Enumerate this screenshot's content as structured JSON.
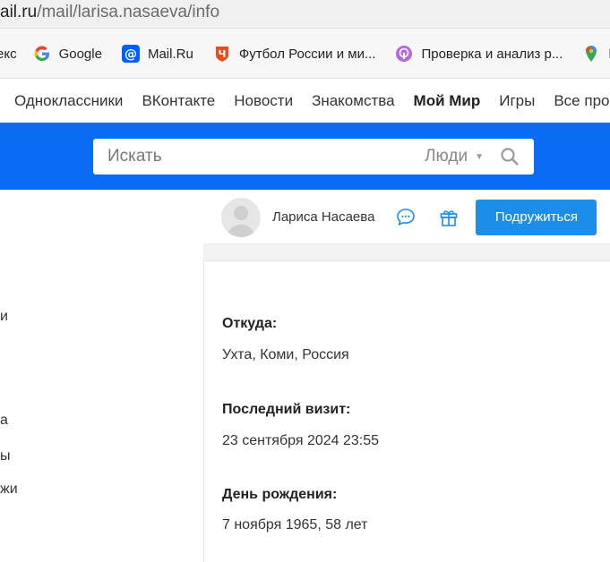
{
  "browser": {
    "url_host": "ail.ru",
    "url_path": "/mail/larisa.nasaeva/info"
  },
  "bookmarks": [
    {
      "label": "екс",
      "icon": "yandex-icon"
    },
    {
      "label": "Google",
      "icon": "google-icon"
    },
    {
      "label": "Mail.Ru",
      "icon": "mailru-icon"
    },
    {
      "label": "Футбол России и ми...",
      "icon": "football-icon"
    },
    {
      "label": "Проверка и анализ р...",
      "icon": "podcast-icon"
    },
    {
      "label": "К",
      "icon": "maps-pin-icon"
    }
  ],
  "portal_nav": [
    {
      "label": "Одноклассники",
      "active": false
    },
    {
      "label": "ВКонтакте",
      "active": false
    },
    {
      "label": "Новости",
      "active": false
    },
    {
      "label": "Знакомства",
      "active": false
    },
    {
      "label": "Мой Мир",
      "active": true
    },
    {
      "label": "Игры",
      "active": false
    },
    {
      "label": "Все про",
      "active": false
    }
  ],
  "search": {
    "placeholder": "Искать",
    "scope": "Люди"
  },
  "sidebar_fragments": [
    "и",
    "а",
    "ы",
    "жи"
  ],
  "profile": {
    "name": "Лариса Насаева",
    "friend_button": "Подружиться"
  },
  "info": {
    "from_label": "Откуда:",
    "from_value": "Ухта, Коми, Россия",
    "last_visit_label": "Последний визит:",
    "last_visit_value": "23 сентября 2024 23:55",
    "birthday_label": "День рождения:",
    "birthday_value": "7 ноября 1965, 58 лет"
  },
  "colors": {
    "brand_blue": "#0a6cf5",
    "button_blue": "#1c8eea"
  }
}
